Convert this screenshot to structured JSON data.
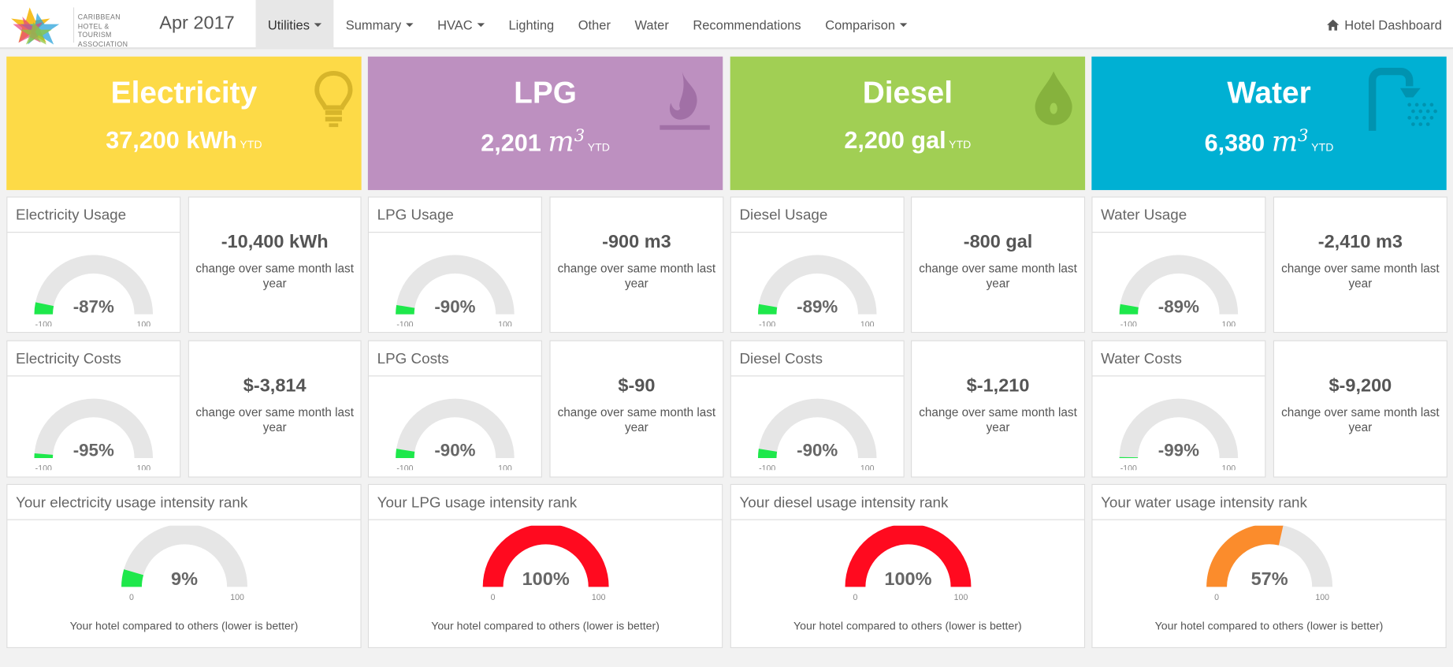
{
  "header": {
    "org_lines": [
      "CARIBBEAN",
      "HOTEL & TOURISM",
      "ASSOCIATION"
    ],
    "period": "Apr 2017",
    "nav": [
      {
        "label": "Utilities",
        "dropdown": true,
        "active": true
      },
      {
        "label": "Summary",
        "dropdown": true
      },
      {
        "label": "HVAC",
        "dropdown": true
      },
      {
        "label": "Lighting"
      },
      {
        "label": "Other"
      },
      {
        "label": "Water"
      },
      {
        "label": "Recommendations"
      },
      {
        "label": "Comparison",
        "dropdown": true
      }
    ],
    "right_link": "Hotel Dashboard",
    "right_icon": "home-icon"
  },
  "tiles": [
    {
      "title": "Electricity",
      "value": "37,200",
      "unit": "kWh",
      "math_unit": false,
      "ytd": "YTD",
      "color": "#fdda47",
      "icon": "lightbulb-icon"
    },
    {
      "title": "LPG",
      "value": "2,201",
      "unit": "m",
      "math_unit": true,
      "sup": "3",
      "ytd": "YTD",
      "color": "#bd90c0",
      "icon": "flame-icon"
    },
    {
      "title": "Diesel",
      "value": "2,200",
      "unit": "gal",
      "math_unit": false,
      "ytd": "YTD",
      "color": "#a1cf54",
      "icon": "drop-icon"
    },
    {
      "title": "Water",
      "value": "6,380",
      "unit": "m",
      "math_unit": true,
      "sup": "3",
      "ytd": "YTD",
      "color": "#00b0d3",
      "icon": "shower-icon"
    }
  ],
  "usage": [
    {
      "label": "Electricity Usage",
      "percent": -87,
      "display": "-87%",
      "min": "-100",
      "max": "100",
      "change": "-10,400 kWh",
      "desc": "change over same month last year"
    },
    {
      "label": "LPG Usage",
      "percent": -90,
      "display": "-90%",
      "min": "-100",
      "max": "100",
      "change": "-900 m3",
      "desc": "change over same month last year"
    },
    {
      "label": "Diesel Usage",
      "percent": -89,
      "display": "-89%",
      "min": "-100",
      "max": "100",
      "change": "-800 gal",
      "desc": "change over same month last year"
    },
    {
      "label": "Water Usage",
      "percent": -89,
      "display": "-89%",
      "min": "-100",
      "max": "100",
      "change": "-2,410 m3",
      "desc": "change over same month last year"
    }
  ],
  "costs": [
    {
      "label": "Electricity Costs",
      "percent": -95,
      "display": "-95%",
      "min": "-100",
      "max": "100",
      "change": "$-3,814",
      "desc": "change over same month last year"
    },
    {
      "label": "LPG Costs",
      "percent": -90,
      "display": "-90%",
      "min": "-100",
      "max": "100",
      "change": "$-90",
      "desc": "change over same month last year"
    },
    {
      "label": "Diesel Costs",
      "percent": -90,
      "display": "-90%",
      "min": "-100",
      "max": "100",
      "change": "$-1,210",
      "desc": "change over same month last year"
    },
    {
      "label": "Water Costs",
      "percent": -99,
      "display": "-99%",
      "min": "-100",
      "max": "100",
      "change": "$-9,200",
      "desc": "change over same month last year"
    }
  ],
  "ranks": [
    {
      "label": "Your electricity usage intensity rank",
      "percent": 9,
      "display": "9%",
      "min": "0",
      "max": "100",
      "color": "#1ee84b",
      "foot": "Your hotel compared to others (lower is better)"
    },
    {
      "label": "Your LPG usage intensity rank",
      "percent": 100,
      "display": "100%",
      "min": "0",
      "max": "100",
      "color": "#ff0a1f",
      "foot": "Your hotel compared to others (lower is better)"
    },
    {
      "label": "Your diesel usage intensity rank",
      "percent": 100,
      "display": "100%",
      "min": "0",
      "max": "100",
      "color": "#ff0a1f",
      "foot": "Your hotel compared to others (lower is better)"
    },
    {
      "label": "Your water usage intensity rank",
      "percent": 57,
      "display": "57%",
      "min": "0",
      "max": "100",
      "color": "#fb8c2c",
      "foot": "Your hotel compared to others (lower is better)"
    }
  ],
  "colors": {
    "gauge_track": "#e6e6e6",
    "gauge_good": "#1ee84b"
  }
}
